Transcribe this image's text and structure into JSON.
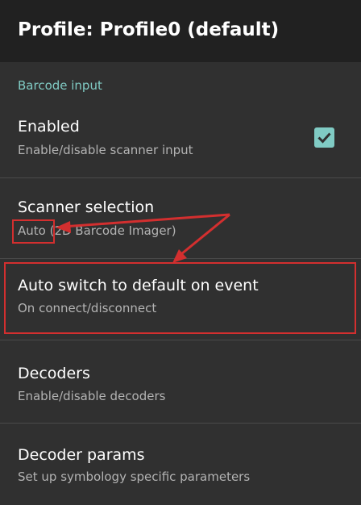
{
  "appbar": {
    "title": "Profile: Profile0 (default)"
  },
  "section": {
    "header": "Barcode input"
  },
  "prefs": [
    {
      "title": "Enabled",
      "summary": "Enable/disable scanner input",
      "checked": true
    },
    {
      "title": "Scanner selection",
      "summary_highlight": "Auto",
      "summary_rest": " (2D Barcode Imager)"
    },
    {
      "title": "Auto switch to default on event",
      "summary": "On connect/disconnect"
    },
    {
      "title": "Decoders",
      "summary": "Enable/disable decoders"
    },
    {
      "title": "Decoder params",
      "summary": "Set up symbology specific parameters"
    }
  ],
  "icons": {
    "checkbox": "check-icon",
    "annotation": "red-arrow-icon"
  },
  "colors": {
    "appbar_bg": "#212121",
    "screen_bg": "#303030",
    "accent": "#80cbc4",
    "annotation": "#d32f2f"
  }
}
